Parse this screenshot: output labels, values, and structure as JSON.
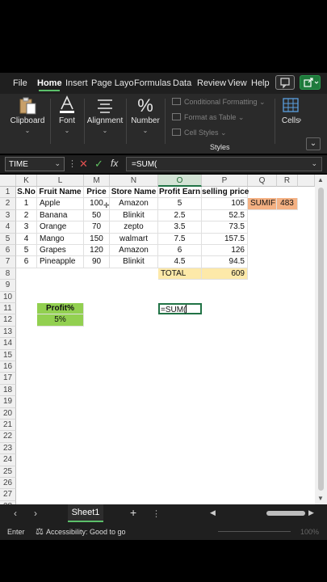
{
  "tabs": [
    {
      "label": "File"
    },
    {
      "label": "Home",
      "active": true
    },
    {
      "label": "Insert"
    },
    {
      "label": "Page Layo"
    },
    {
      "label": "Formulas"
    },
    {
      "label": "Data"
    },
    {
      "label": "Review"
    },
    {
      "label": "View"
    },
    {
      "label": "Help"
    }
  ],
  "ribbon": {
    "clipboard": "Clipboard",
    "font": "Font",
    "alignment": "Alignment",
    "number": "Number",
    "number_symbol": "%",
    "conditional": "Conditional Formatting",
    "format_table": "Format as Table",
    "cell_styles": "Cell Styles",
    "styles": "Styles",
    "cells": "Cells"
  },
  "formula_bar": {
    "name_box": "TIME",
    "fx": "fx",
    "formula": "=SUM("
  },
  "columns": [
    "K",
    "L",
    "M",
    "N",
    "O",
    "P",
    "Q",
    "R"
  ],
  "selected_column": "O",
  "rows": [
    "1",
    "2",
    "3",
    "4",
    "5",
    "6",
    "7",
    "8",
    "9",
    "10",
    "11",
    "12",
    "13",
    "14",
    "15",
    "16",
    "17",
    "18",
    "19",
    "20",
    "21",
    "22",
    "23",
    "24",
    "25",
    "26",
    "27",
    "28"
  ],
  "table": {
    "headers": [
      "S.No",
      "Fruit Name",
      "Price",
      "Store Name",
      "Profit Earn",
      "selling price"
    ],
    "data": [
      [
        "1",
        "Apple",
        "100",
        "Amazon",
        "5",
        "105"
      ],
      [
        "2",
        "Banana",
        "50",
        "Blinkit",
        "2.5",
        "52.5"
      ],
      [
        "3",
        "Orange",
        "70",
        "zepto",
        "3.5",
        "73.5"
      ],
      [
        "4",
        "Mango",
        "150",
        "walmart",
        "7.5",
        "157.5"
      ],
      [
        "5",
        "Grapes",
        "120",
        "Amazon",
        "6",
        "126"
      ],
      [
        "6",
        "Pineapple",
        "90",
        "Blinkit",
        "4.5",
        "94.5"
      ]
    ],
    "total_label": "TOTAL",
    "total_value": "609"
  },
  "sumif": {
    "label": "SUMIF",
    "value": "483"
  },
  "profit": {
    "label": "Profit%",
    "value": "5%"
  },
  "active_cell_text": "=SUM(",
  "sheet": {
    "name": "Sheet1",
    "add": "+"
  },
  "status": {
    "mode": "Enter",
    "accessibility": "Accessibility: Good to go",
    "zoom": "100%"
  },
  "colors": {
    "accent": "#217346",
    "sumif_fill": "#f4b183",
    "total_fill": "#fde9a9",
    "profit_fill": "#92d050"
  }
}
